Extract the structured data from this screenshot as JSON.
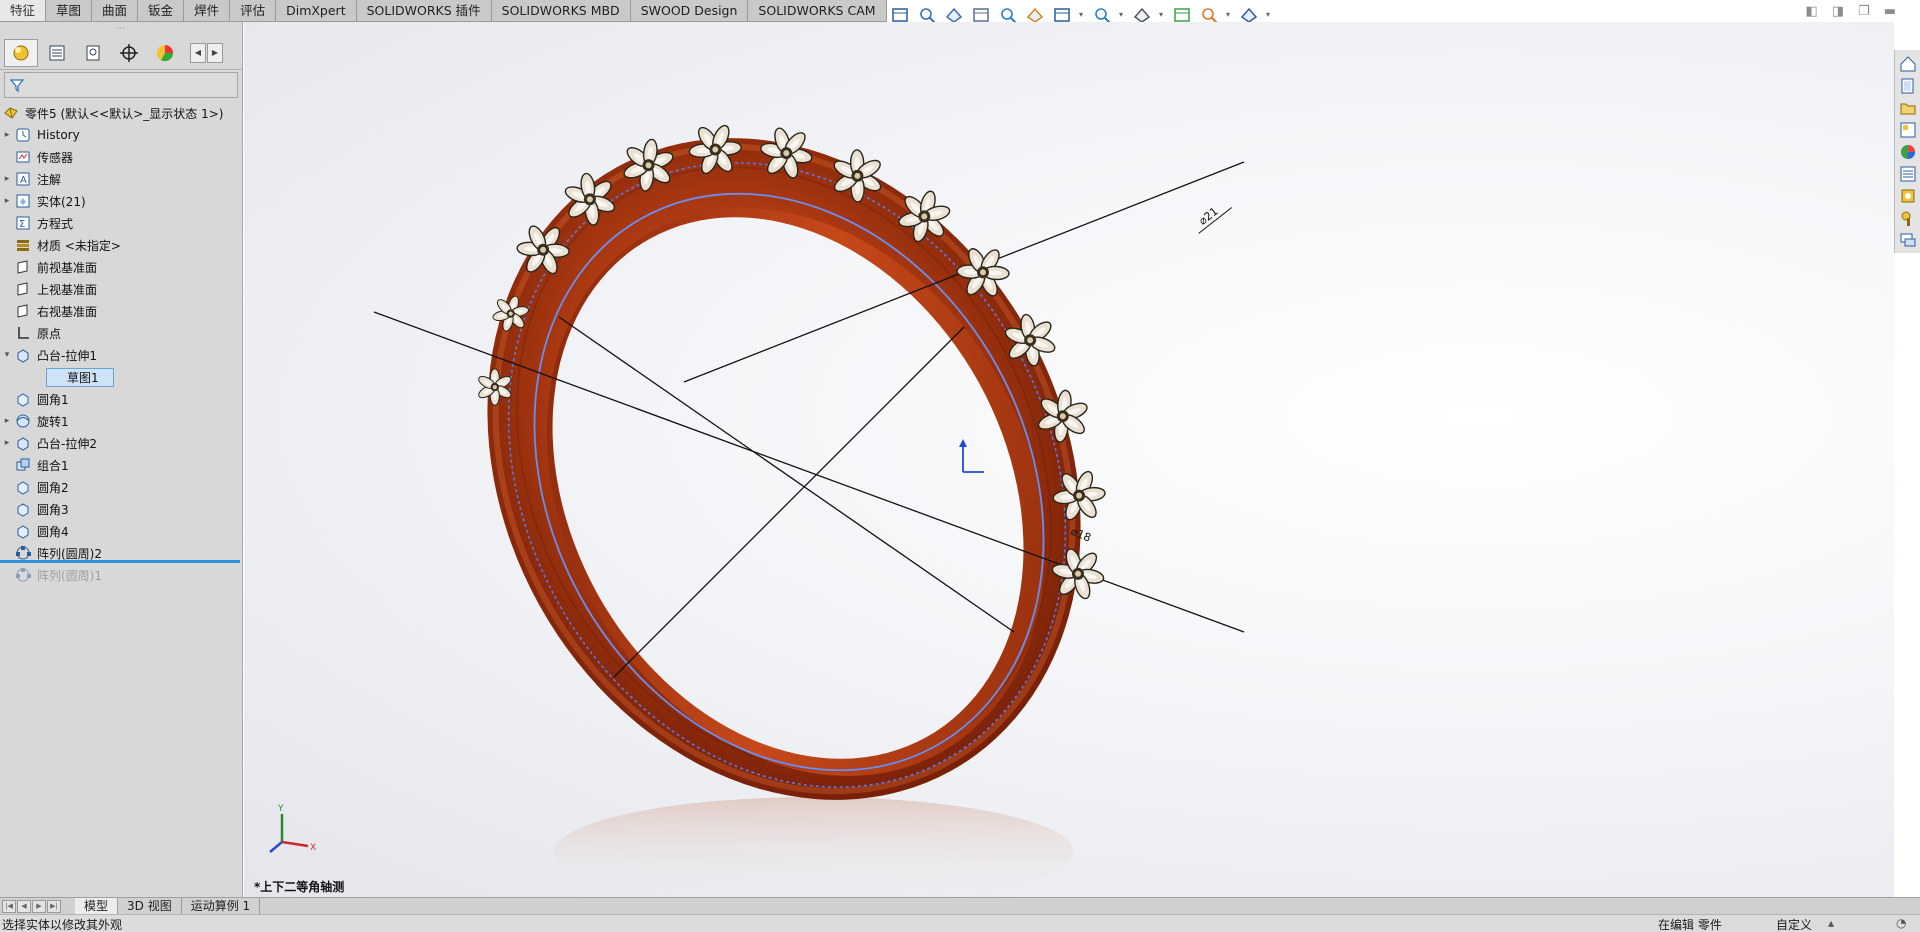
{
  "command_tabs": [
    "特征",
    "草图",
    "曲面",
    "钣金",
    "焊件",
    "评估",
    "DimXpert",
    "SOLIDWORKS 插件",
    "SOLIDWORKS MBD",
    "SWOOD Design",
    "SOLIDWORKS CAM"
  ],
  "hud_icons": [
    "view-orientation-icon",
    "zoom-to-fit-icon",
    "zoom-to-area-icon",
    "previous-view-icon",
    "section-view-icon",
    "dynamic-annotation-icon",
    "view-orientation-cube-icon",
    "display-style-icon",
    "hide-show-icon",
    "edit-appearance-icon",
    "apply-scene-icon",
    "view-settings-icon"
  ],
  "feature_tree": {
    "root": "零件5 (默认<<默认>_显示状态 1>)",
    "items": [
      {
        "label": "History",
        "icon": "history-icon",
        "expandable": true
      },
      {
        "label": "传感器",
        "icon": "sensor-icon",
        "expandable": false
      },
      {
        "label": "注解",
        "icon": "annotation-icon",
        "expandable": true
      },
      {
        "label": "实体(21)",
        "icon": "solid-bodies-icon",
        "expandable": true
      },
      {
        "label": "方程式",
        "icon": "equation-icon",
        "expandable": false
      },
      {
        "label": "材质 <未指定>",
        "icon": "material-icon",
        "expandable": false
      },
      {
        "label": "前视基准面",
        "icon": "plane-icon",
        "expandable": false
      },
      {
        "label": "上视基准面",
        "icon": "plane-icon",
        "expandable": false
      },
      {
        "label": "右视基准面",
        "icon": "plane-icon",
        "expandable": false
      },
      {
        "label": "原点",
        "icon": "origin-icon",
        "expandable": false
      },
      {
        "label": "凸台-拉伸1",
        "icon": "extrude-icon",
        "expandable": true,
        "expanded": true
      },
      {
        "label": "草图1",
        "icon": "sketch-icon",
        "child": true,
        "selected": true
      },
      {
        "label": "圆角1",
        "icon": "fillet-icon",
        "expandable": false
      },
      {
        "label": "旋转1",
        "icon": "revolve-icon",
        "expandable": true
      },
      {
        "label": "凸台-拉伸2",
        "icon": "extrude-icon",
        "expandable": true
      },
      {
        "label": "组合1",
        "icon": "combine-icon",
        "expandable": false
      },
      {
        "label": "圆角2",
        "icon": "fillet-icon",
        "expandable": false
      },
      {
        "label": "圆角3",
        "icon": "fillet-icon",
        "expandable": false
      },
      {
        "label": "圆角4",
        "icon": "fillet-icon",
        "expandable": false
      },
      {
        "label": "阵列(圆周)2",
        "icon": "circular-pattern-icon",
        "expandable": false
      },
      {
        "label": "阵列(圆周)1",
        "icon": "circular-pattern-icon",
        "expandable": false,
        "suppressed": true
      }
    ]
  },
  "dimensions": {
    "outer": "⌀21",
    "inner": "⌀18"
  },
  "view_name": "*上下二等角轴测",
  "triad": {
    "x": "X",
    "y": "Y"
  },
  "bottom_tabs": [
    "模型",
    "3D 视图",
    "运动算例 1"
  ],
  "status": {
    "left": "选择实体以修改其外观",
    "editing": "在编辑 零件",
    "custom": "自定义"
  },
  "colors": {
    "wood": "#b23c12",
    "wood_dark": "#6a1a06",
    "sketch_blue": "#4a7ad8",
    "rollback_bar": "#2f8fd8"
  }
}
